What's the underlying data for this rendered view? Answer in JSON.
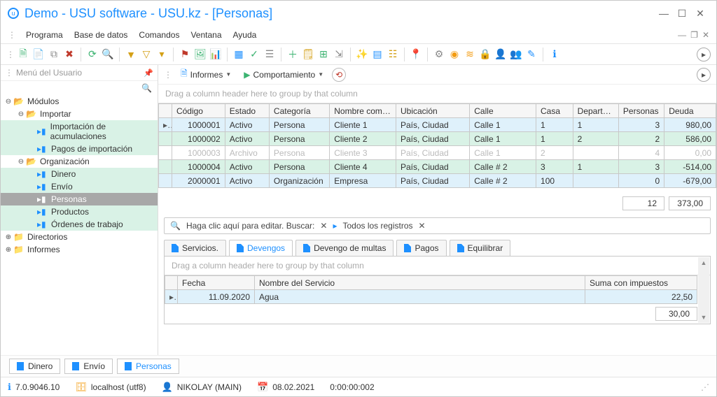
{
  "title": "Demo - USU software - USU.kz - [Personas]",
  "menu": {
    "programa": "Programa",
    "basedatos": "Base de datos",
    "comandos": "Comandos",
    "ventana": "Ventana",
    "ayuda": "Ayuda"
  },
  "sidebar": {
    "header": "Menú del Usuario",
    "nodes": {
      "modulos": "Módulos",
      "importar": "Importar",
      "importacion_acum": "Importación de acumulaciones",
      "pagos_import": "Pagos de importación",
      "organizacion": "Organización",
      "dinero": "Dinero",
      "envio": "Envío",
      "personas": "Personas",
      "productos": "Productos",
      "ordenes": "Órdenes de trabajo",
      "directorios": "Directorios",
      "informes": "Informes"
    }
  },
  "subtoolbar": {
    "informes": "Informes",
    "comport": "Comportamiento"
  },
  "group_hint": "Drag a column header here to group by that column",
  "grid": {
    "headers": {
      "codigo": "Código",
      "estado": "Estado",
      "categoria": "Categoría",
      "nombre": "Nombre comp...",
      "ubicacion": "Ubicación",
      "calle": "Calle",
      "casa": "Casa",
      "departa": "Departa...",
      "personas": "Personas",
      "deuda": "Deuda"
    },
    "rows": [
      {
        "codigo": "1000001",
        "estado": "Activo",
        "categoria": "Persona",
        "nombre": "Cliente 1",
        "ubicacion": "País, Ciudad",
        "calle": "Calle 1",
        "casa": "1",
        "departa": "1",
        "personas": "3",
        "deuda": "980,00",
        "cls": "row-blue",
        "mark": "▸"
      },
      {
        "codigo": "1000002",
        "estado": "Activo",
        "categoria": "Persona",
        "nombre": "Cliente 2",
        "ubicacion": "País, Ciudad",
        "calle": "Calle 1",
        "casa": "1",
        "departa": "2",
        "personas": "2",
        "deuda": "586,00",
        "cls": "row-green",
        "mark": ""
      },
      {
        "codigo": "1000003",
        "estado": "Archivo",
        "categoria": "Persona",
        "nombre": "Cliente 3",
        "ubicacion": "País, Ciudad",
        "calle": "Calle 1",
        "casa": "2",
        "departa": "",
        "personas": "4",
        "deuda": "0,00",
        "cls": "row-dim",
        "mark": ""
      },
      {
        "codigo": "1000004",
        "estado": "Activo",
        "categoria": "Persona",
        "nombre": "Cliente 4",
        "ubicacion": "País, Ciudad",
        "calle": "Calle # 2",
        "casa": "3",
        "departa": "1",
        "personas": "3",
        "deuda": "-514,00",
        "cls": "row-green",
        "mark": ""
      },
      {
        "codigo": "2000001",
        "estado": "Activo",
        "categoria": "Organización",
        "nombre": "Empresa",
        "ubicacion": "País, Ciudad",
        "calle": "Calle # 2",
        "casa": "100",
        "departa": "",
        "personas": "0",
        "deuda": "-679,00",
        "cls": "row-blue",
        "mark": ""
      }
    ],
    "totals": {
      "personas": "12",
      "deuda": "373,00"
    }
  },
  "searchbar": {
    "edit": "Haga clic aquí para editar. Buscar:",
    "all": "Todos los registros"
  },
  "detail_tabs": {
    "servicios": "Servicios.",
    "devengos": "Devengos",
    "multas": "Devengo de multas",
    "pagos": "Pagos",
    "equilibrar": "Equilibrar"
  },
  "detail": {
    "headers": {
      "fecha": "Fecha",
      "servicio": "Nombre del Servicio",
      "suma": "Suma con impuestos"
    },
    "rows": [
      {
        "fecha": "11.09.2020",
        "servicio": "Agua",
        "suma": "22,50",
        "mark": "▸"
      }
    ],
    "total": "30,00"
  },
  "bottom_tabs": {
    "dinero": "Dinero",
    "envio": "Envío",
    "personas": "Personas"
  },
  "status": {
    "version": "7.0.9046.10",
    "host": "localhost (utf8)",
    "user": "NIKOLAY (MAIN)",
    "date": "08.02.2021",
    "time": "0:00:00:002"
  }
}
